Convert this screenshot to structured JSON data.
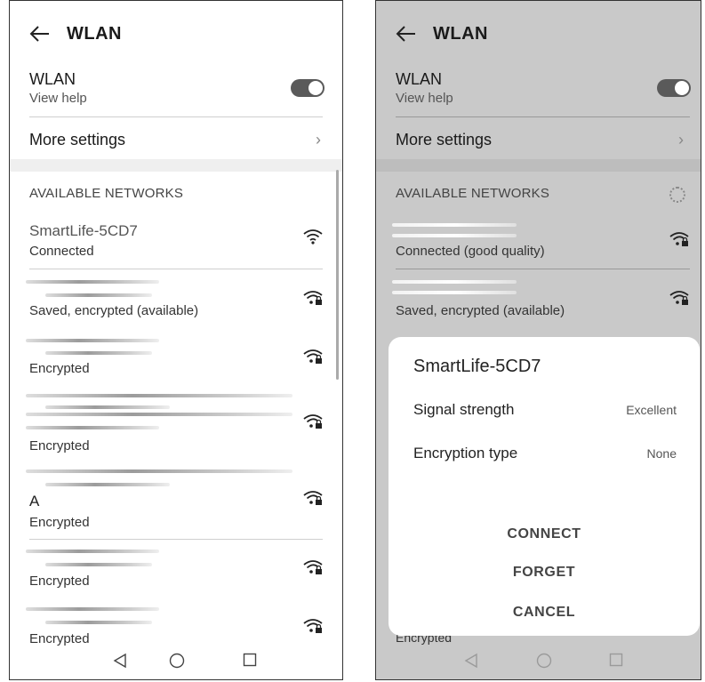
{
  "header": {
    "title": "WLAN"
  },
  "wlan_toggle": {
    "label": "WLAN",
    "sublabel": "View help",
    "state": "on"
  },
  "more_settings": {
    "label": "More settings"
  },
  "section_label": "AVAILABLE NETWORKS",
  "left_networks": [
    {
      "name": "SmartLife-5CD7",
      "status": "Connected"
    },
    {
      "name": "",
      "status": "Saved, encrypted (available)"
    },
    {
      "name": "",
      "status": "Encrypted"
    },
    {
      "name": "",
      "status": "Encrypted"
    },
    {
      "name": "A",
      "status": "Encrypted"
    },
    {
      "name": "",
      "status": "Encrypted"
    },
    {
      "name": "",
      "status": "Encrypted"
    }
  ],
  "right_networks": [
    {
      "name": "",
      "status": "Connected (good quality)"
    },
    {
      "name": "",
      "status": "Saved, encrypted (available)"
    },
    {
      "name": "",
      "status": "Encrypted"
    }
  ],
  "dialog": {
    "title": "SmartLife-5CD7",
    "rows": [
      {
        "label": "Signal strength",
        "value": "Excellent"
      },
      {
        "label": "Encryption type",
        "value": "None"
      }
    ],
    "buttons": {
      "connect": "CONNECT",
      "forget": "FORGET",
      "cancel": "CANCEL"
    }
  },
  "icons": {
    "back": "back-arrow-icon",
    "wifi_open": "wifi-icon",
    "wifi_locked": "wifi-lock-icon",
    "spinner": "loading-spinner-icon",
    "nav": [
      "nav-back-icon",
      "nav-home-icon",
      "nav-recents-icon"
    ]
  }
}
